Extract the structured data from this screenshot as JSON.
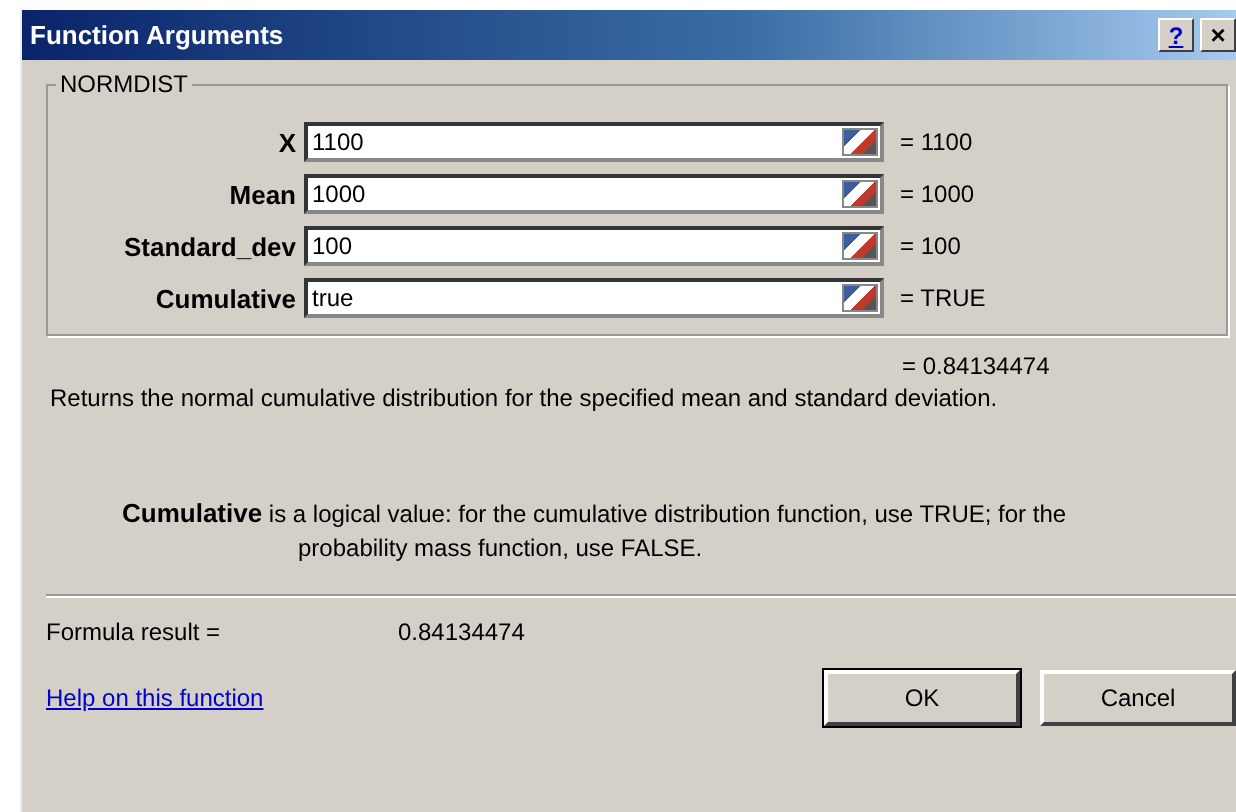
{
  "window": {
    "title": "Function Arguments",
    "buttons": [
      {
        "kind": "help",
        "label": "?"
      },
      {
        "kind": "close",
        "label": "×"
      }
    ]
  },
  "function_group": {
    "name": "NORMDIST",
    "arguments": [
      {
        "label": "X",
        "value": "1100",
        "result": "= 1100"
      },
      {
        "label": "Mean",
        "value": "1000",
        "result": "= 1000"
      },
      {
        "label": "Standard_dev",
        "value": "100",
        "result": "= 100"
      },
      {
        "label": "Cumulative",
        "value": "true",
        "result": "= TRUE"
      }
    ]
  },
  "function_result": "= 0.84134474",
  "description": "Returns the normal cumulative distribution for the specified mean and standard deviation.",
  "argument_help": "**Cumulative** is a logical value: for the cumulative distribution function, use TRUE; for the probability mass function, use FALSE.",
  "formula_result": {
    "label": "Formula result =",
    "value": "0.84134474"
  },
  "help_link": "Help on this function",
  "buttons": [
    "OK",
    "Cancel"
  ]
}
